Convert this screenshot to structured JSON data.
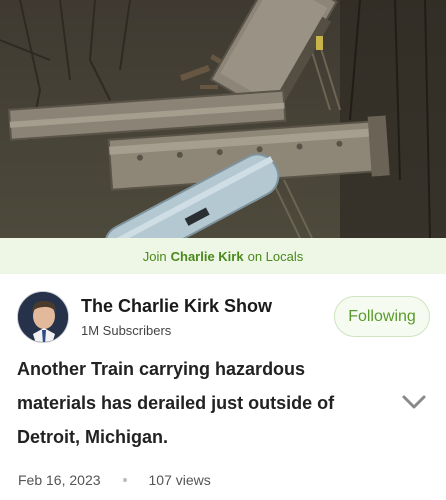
{
  "locals_banner": {
    "prefix": "Join",
    "name": "Charlie Kirk",
    "suffix": "on Locals"
  },
  "channel": {
    "name": "The Charlie Kirk Show",
    "subscribers": "1M Subscribers",
    "follow_label": "Following"
  },
  "video": {
    "title": "Another Train carrying hazardous materials has derailed just outside of Detroit, Michigan.",
    "date": "Feb 16, 2023",
    "views": "107 views"
  },
  "icons": {
    "expand": "chevron-down-icon",
    "avatar": "avatar"
  },
  "colors": {
    "accent_green": "#5a9a2c",
    "banner_bg": "#eef6e6"
  }
}
